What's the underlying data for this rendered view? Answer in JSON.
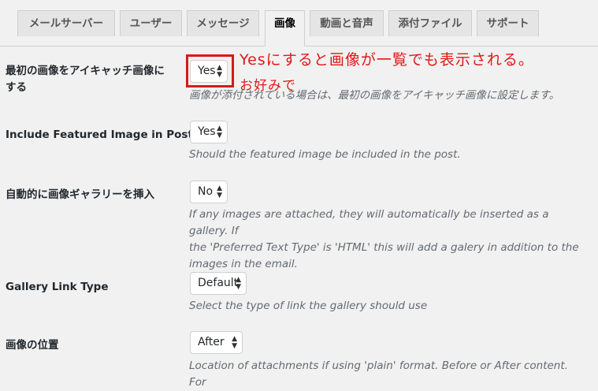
{
  "tabs": [
    {
      "label": "メールサーバー",
      "active": false
    },
    {
      "label": "ユーザー",
      "active": false
    },
    {
      "label": "メッセージ",
      "active": false
    },
    {
      "label": "画像",
      "active": true
    },
    {
      "label": "動画と音声",
      "active": false
    },
    {
      "label": "添付ファイル",
      "active": false
    },
    {
      "label": "サポート",
      "active": false
    }
  ],
  "settings": [
    {
      "label_line1": "最初の画像をアイキャッチ画像に",
      "label_line2": "する",
      "value": "Yes",
      "description": "画像が添付されている場合は、最初の画像をアイキャッチ画像に設定します。"
    },
    {
      "label_line1": "Include Featured Image in Post",
      "value": "Yes",
      "description": "Should the featured image be included in the post."
    },
    {
      "label_line1": "自動的に画像ギャラリーを挿入",
      "value": "No",
      "description_lines": [
        "If any images are attached, they will automatically be inserted as a gallery. If",
        "the 'Preferred Text Type' is 'HTML' this will add a galery in addition to the",
        "images in the email."
      ]
    },
    {
      "label_line1": "Gallery Link Type",
      "value": "Default",
      "description": "Select the type of link the gallery should use"
    },
    {
      "label_line1": "画像の位置",
      "value": "After",
      "description": "Location of attachments if using 'plain' format. Before or After content. For"
    }
  ],
  "annotation": {
    "line1": "Yesにすると画像が一覧でも表示される。",
    "line2": "お好みで",
    "color": "#e01818"
  }
}
